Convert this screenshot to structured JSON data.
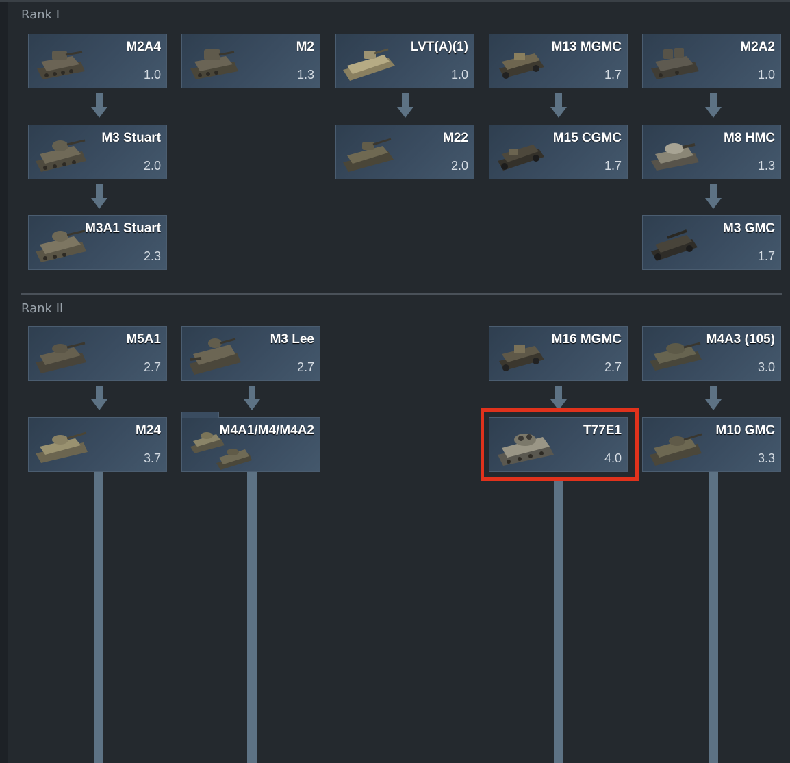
{
  "ranks": [
    {
      "label": "Rank I"
    },
    {
      "label": "Rank II"
    }
  ],
  "vehicles": {
    "m2a4": {
      "name": "M2A4",
      "br": "1.0"
    },
    "m2": {
      "name": "M2",
      "br": "1.3"
    },
    "lvta1": {
      "name": "LVT(A)(1)",
      "br": "1.0"
    },
    "m13mgmc": {
      "name": "M13 MGMC",
      "br": "1.7"
    },
    "m2a2": {
      "name": "M2A2",
      "br": "1.0"
    },
    "m3stuart": {
      "name": "M3 Stuart",
      "br": "2.0"
    },
    "m22": {
      "name": "M22",
      "br": "2.0"
    },
    "m15cgmc": {
      "name": "M15 CGMC",
      "br": "1.7"
    },
    "m8hmc": {
      "name": "M8 HMC",
      "br": "1.3"
    },
    "m3a1stuart": {
      "name": "M3A1 Stuart",
      "br": "2.3"
    },
    "m3gmc": {
      "name": "M3 GMC",
      "br": "1.7"
    },
    "m5a1": {
      "name": "M5A1",
      "br": "2.7"
    },
    "m3lee": {
      "name": "M3 Lee",
      "br": "2.7"
    },
    "m16mgmc": {
      "name": "M16 MGMC",
      "br": "2.7"
    },
    "m4a3_105": {
      "name": "M4A3 (105)",
      "br": "3.0"
    },
    "m24": {
      "name": "M24",
      "br": "3.7"
    },
    "m4group": {
      "name": "M4A1/M4/M4A2",
      "br": ""
    },
    "t77e1": {
      "name": "T77E1",
      "br": "4.0"
    },
    "m10gmc": {
      "name": "M10 GMC",
      "br": "3.3"
    }
  },
  "colors": {
    "background": "#24292e",
    "card": "#3a4c60",
    "connector": "#5d7284",
    "highlight": "#e0321c"
  }
}
